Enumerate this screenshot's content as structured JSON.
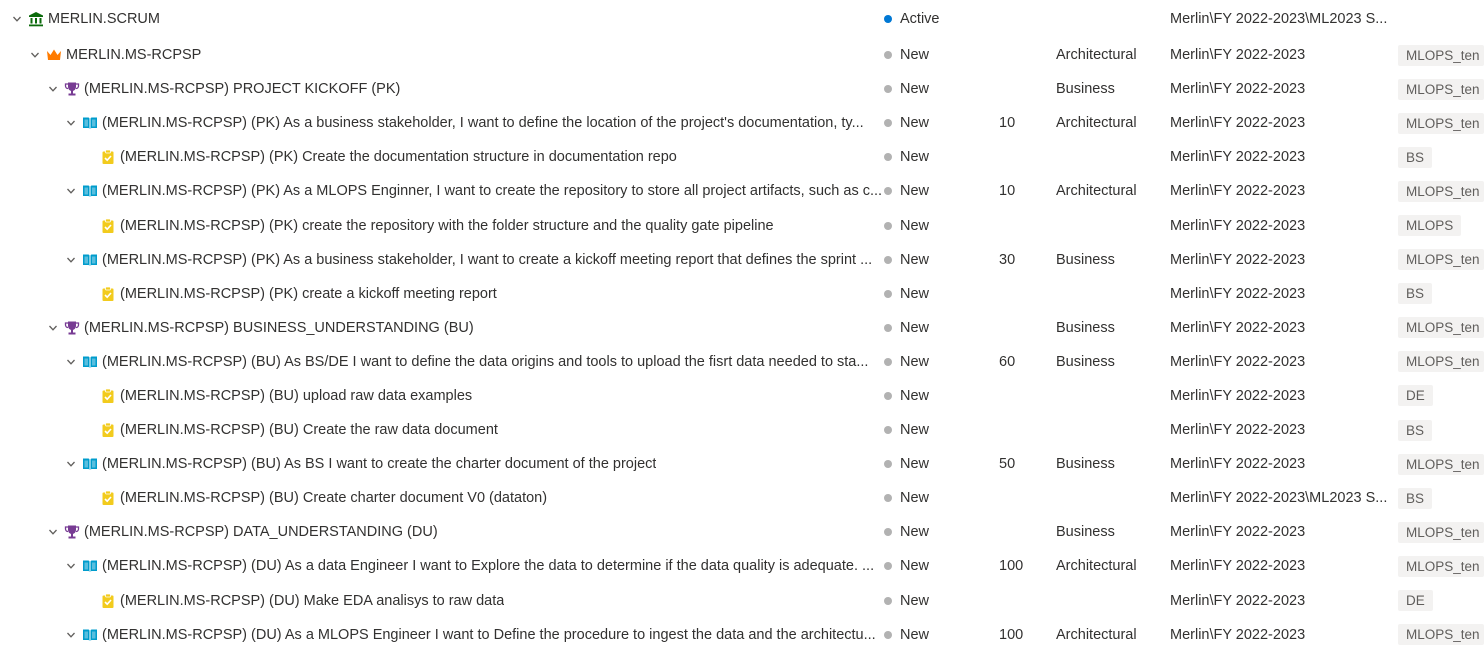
{
  "colors": {
    "active_dot": "#0078d4",
    "new_dot": "#b2b2b2",
    "epic_icon": "#ff7b00",
    "feature_icon": "#773b93",
    "story_icon": "#009ccc",
    "task_icon": "#f2cb1d",
    "project_icon": "#0b6a0b"
  },
  "rows": [
    {
      "level": 0,
      "expandable": true,
      "icon": "bank-icon",
      "title": "MERLIN.SCRUM",
      "state": "Active",
      "effort": "",
      "area": "",
      "iteration": "Merlin\\FY 2022-2023\\ML2023 S...",
      "tag": ""
    },
    {
      "level": 1,
      "expandable": true,
      "icon": "crown-icon",
      "title": "MERLIN.MS-RCPSP",
      "state": "New",
      "effort": "",
      "area": "Architectural",
      "iteration": "Merlin\\FY 2022-2023",
      "tag": "MLOPS_ten"
    },
    {
      "level": 2,
      "expandable": true,
      "icon": "trophy-icon",
      "title": "(MERLIN.MS-RCPSP) PROJECT KICKOFF (PK)",
      "state": "New",
      "effort": "",
      "area": "Business",
      "iteration": "Merlin\\FY 2022-2023",
      "tag": "MLOPS_ten"
    },
    {
      "level": 3,
      "expandable": true,
      "icon": "book-icon",
      "title": "(MERLIN.MS-RCPSP) (PK) As a business stakeholder, I want to define the location of the project's documentation, ty...",
      "state": "New",
      "effort": "10",
      "area": "Architectural",
      "iteration": "Merlin\\FY 2022-2023",
      "tag": "MLOPS_ten"
    },
    {
      "level": 4,
      "expandable": false,
      "icon": "clipboard-check-icon",
      "title": "(MERLIN.MS-RCPSP) (PK) Create the documentation structure in documentation repo",
      "state": "New",
      "effort": "",
      "area": "",
      "iteration": "Merlin\\FY 2022-2023",
      "tag": "BS"
    },
    {
      "level": 3,
      "expandable": true,
      "icon": "book-icon",
      "title": "(MERLIN.MS-RCPSP) (PK) As a MLOPS Enginner, I want to create the repository to store all project artifacts, such as c...",
      "state": "New",
      "effort": "10",
      "area": "Architectural",
      "iteration": "Merlin\\FY 2022-2023",
      "tag": "MLOPS_ten"
    },
    {
      "level": 4,
      "expandable": false,
      "icon": "clipboard-check-icon",
      "title": "(MERLIN.MS-RCPSP) (PK) create the repository with the folder structure and the quality gate pipeline",
      "state": "New",
      "effort": "",
      "area": "",
      "iteration": "Merlin\\FY 2022-2023",
      "tag": "MLOPS"
    },
    {
      "level": 3,
      "expandable": true,
      "icon": "book-icon",
      "title": "(MERLIN.MS-RCPSP) (PK) As a business stakeholder, I want to create a kickoff meeting report that defines the sprint ...",
      "state": "New",
      "effort": "30",
      "area": "Business",
      "iteration": "Merlin\\FY 2022-2023",
      "tag": "MLOPS_ten"
    },
    {
      "level": 4,
      "expandable": false,
      "icon": "clipboard-check-icon",
      "title": "(MERLIN.MS-RCPSP) (PK) create a kickoff meeting report",
      "state": "New",
      "effort": "",
      "area": "",
      "iteration": "Merlin\\FY 2022-2023",
      "tag": "BS"
    },
    {
      "level": 2,
      "expandable": true,
      "icon": "trophy-icon",
      "title": "(MERLIN.MS-RCPSP) BUSINESS_UNDERSTANDING (BU)",
      "state": "New",
      "effort": "",
      "area": "Business",
      "iteration": "Merlin\\FY 2022-2023",
      "tag": "MLOPS_ten"
    },
    {
      "level": 3,
      "expandable": true,
      "icon": "book-icon",
      "title": "(MERLIN.MS-RCPSP) (BU) As BS/DE I want to define the data origins and tools to upload the fisrt data needed to sta...",
      "state": "New",
      "effort": "60",
      "area": "Business",
      "iteration": "Merlin\\FY 2022-2023",
      "tag": "MLOPS_ten"
    },
    {
      "level": 4,
      "expandable": false,
      "icon": "clipboard-check-icon",
      "title": "(MERLIN.MS-RCPSP) (BU) upload raw data examples",
      "state": "New",
      "effort": "",
      "area": "",
      "iteration": "Merlin\\FY 2022-2023",
      "tag": "DE"
    },
    {
      "level": 4,
      "expandable": false,
      "icon": "clipboard-check-icon",
      "title": "(MERLIN.MS-RCPSP) (BU) Create the raw data document",
      "state": "New",
      "effort": "",
      "area": "",
      "iteration": "Merlin\\FY 2022-2023",
      "tag": "BS"
    },
    {
      "level": 3,
      "expandable": true,
      "icon": "book-icon",
      "title": "(MERLIN.MS-RCPSP) (BU) As BS I want to create the charter document of the project",
      "state": "New",
      "effort": "50",
      "area": "Business",
      "iteration": "Merlin\\FY 2022-2023",
      "tag": "MLOPS_ten"
    },
    {
      "level": 4,
      "expandable": false,
      "icon": "clipboard-check-icon",
      "title": "(MERLIN.MS-RCPSP) (BU) Create charter document V0 (dataton)",
      "state": "New",
      "effort": "",
      "area": "",
      "iteration": "Merlin\\FY 2022-2023\\ML2023 S...",
      "tag": "BS"
    },
    {
      "level": 2,
      "expandable": true,
      "icon": "trophy-icon",
      "title": "(MERLIN.MS-RCPSP) DATA_UNDERSTANDING (DU)",
      "state": "New",
      "effort": "",
      "area": "Business",
      "iteration": "Merlin\\FY 2022-2023",
      "tag": "MLOPS_ten"
    },
    {
      "level": 3,
      "expandable": true,
      "icon": "book-icon",
      "title": "(MERLIN.MS-RCPSP) (DU) As a data Engineer I want to Explore the data to determine if the data quality is adequate. ...",
      "state": "New",
      "effort": "100",
      "area": "Architectural",
      "iteration": "Merlin\\FY 2022-2023",
      "tag": "MLOPS_ten"
    },
    {
      "level": 4,
      "expandable": false,
      "icon": "clipboard-check-icon",
      "title": "(MERLIN.MS-RCPSP) (DU) Make EDA analisys to raw data",
      "state": "New",
      "effort": "",
      "area": "",
      "iteration": "Merlin\\FY 2022-2023",
      "tag": "DE"
    },
    {
      "level": 3,
      "expandable": true,
      "icon": "book-icon",
      "title": "(MERLIN.MS-RCPSP) (DU) As a MLOPS Engineer I want to Define the procedure to ingest the data and the architectu...",
      "state": "New",
      "effort": "100",
      "area": "Architectural",
      "iteration": "Merlin\\FY 2022-2023",
      "tag": "MLOPS_ten"
    }
  ]
}
